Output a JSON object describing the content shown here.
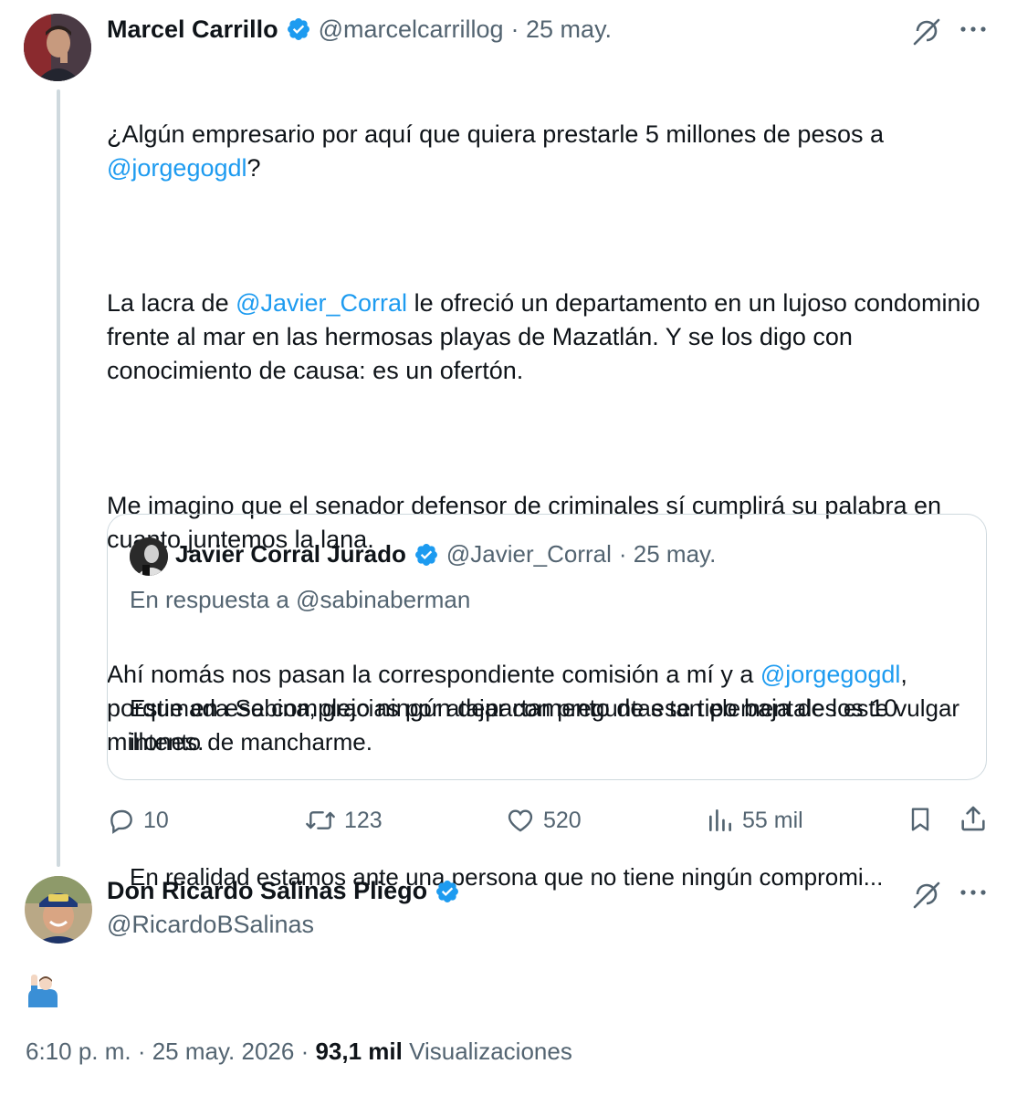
{
  "tweet1": {
    "author": {
      "name": "Marcel Carrillo",
      "handle": "@marcelcarrillog",
      "date": "· 25 may."
    },
    "text_line1": "¿Algún empresario por aquí que quiera prestarle 5 millones de pesos a",
    "mention1": "@jorgegogdl",
    "after_mention1": "?",
    "p2_a": "La lacra de ",
    "mention2": "@Javier_Corral",
    "p2_b": " le ofreció un departamento en un lujoso condominio frente al mar en las hermosas playas de Mazatlán. Y se los digo con conocimiento de causa: es un ofertón.",
    "p3": "Me imagino que el senador defensor de criminales sí cumplirá su palabra en cuanto juntemos la lana.",
    "p4_a": "Ahí nomás nos pasan la correspondiente comisión a mí y a ",
    "mention3": "@jorgegogdl",
    "p4_b": ", porque en ese complejo ningún departamento de ese tipo baja de los 10 millones.",
    "quote": {
      "name": "Javier Corral Jurado",
      "handle": "@Javier_Corral",
      "date": "· 25 may.",
      "reply_to": "En respuesta a @sabinaberman",
      "line1": "Estimada Sabina, gracias por atajar con preguntas tan elementales este vulgar intento de mancharme.",
      "line2": "En realidad estamos ante una persona que no tiene ningún compromi..."
    },
    "actions": {
      "replies": "10",
      "retweets": "123",
      "likes": "520",
      "views": "55 mil"
    }
  },
  "tweet2": {
    "author": {
      "name": "Don Ricardo Salinas Pliego",
      "handle": "@RicardoBSalinas"
    },
    "text": "🙋🏻‍♂️",
    "footer": {
      "time": "6:10 p. m. · 25 may. 2026 · ",
      "views_count": "93,1 mil",
      "views_label": " Visualizaciones"
    }
  },
  "colors": {
    "accent": "#1d9bf0",
    "muted": "#536471",
    "border": "#cfd9de"
  },
  "icons": [
    "verified-badge-icon",
    "grok-icon",
    "more-icon",
    "reply-icon",
    "retweet-icon",
    "like-icon",
    "views-icon",
    "bookmark-icon",
    "share-icon"
  ]
}
